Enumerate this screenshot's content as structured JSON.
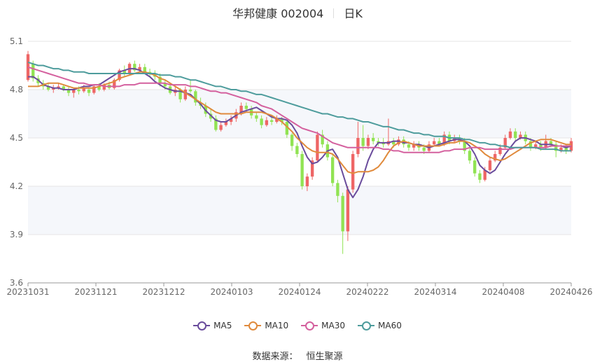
{
  "header": {
    "name": "华邦健康 002004",
    "period": "日K"
  },
  "source": {
    "label": "数据来源：",
    "value": "恒生聚源"
  },
  "chart_data": {
    "type": "candlestick",
    "ylim": [
      3.6,
      5.1
    ],
    "y_ticks": [
      "3.6",
      "3.9",
      "4.2",
      "4.5",
      "4.8",
      "5.1"
    ],
    "x_ticks": [
      "20231031",
      "20231121",
      "20231212",
      "20240103",
      "20240124",
      "20240222",
      "20240314",
      "20240408",
      "20240426"
    ],
    "colors": {
      "up": "#ee6666",
      "down": "#91e353"
    },
    "candles": [
      [
        4.86,
        5.02,
        5.04,
        4.85
      ],
      [
        4.96,
        4.87,
        4.98,
        4.85
      ],
      [
        4.87,
        4.84,
        4.89,
        4.82
      ],
      [
        4.84,
        4.82,
        4.86,
        4.8
      ],
      [
        4.82,
        4.8,
        4.84,
        4.79
      ],
      [
        4.8,
        4.81,
        4.83,
        4.78
      ],
      [
        4.81,
        4.82,
        4.84,
        4.8
      ],
      [
        4.82,
        4.8,
        4.83,
        4.79
      ],
      [
        4.8,
        4.78,
        4.82,
        4.76
      ],
      [
        4.78,
        4.8,
        4.81,
        4.75
      ],
      [
        4.8,
        4.79,
        4.82,
        4.77
      ],
      [
        4.79,
        4.81,
        4.83,
        4.78
      ],
      [
        4.8,
        4.78,
        4.81,
        4.76
      ],
      [
        4.78,
        4.82,
        4.83,
        4.77
      ],
      [
        4.82,
        4.8,
        4.84,
        4.79
      ],
      [
        4.8,
        4.83,
        4.84,
        4.79
      ],
      [
        4.83,
        4.81,
        4.85,
        4.8
      ],
      [
        4.81,
        4.86,
        4.87,
        4.8
      ],
      [
        4.86,
        4.92,
        4.93,
        4.85
      ],
      [
        4.92,
        4.9,
        4.95,
        4.88
      ],
      [
        4.9,
        4.96,
        4.97,
        4.89
      ],
      [
        4.96,
        4.92,
        4.98,
        4.91
      ],
      [
        4.92,
        4.94,
        4.96,
        4.91
      ],
      [
        4.94,
        4.91,
        4.96,
        4.9
      ],
      [
        4.91,
        4.9,
        4.93,
        4.88
      ],
      [
        4.9,
        4.88,
        4.92,
        4.86
      ],
      [
        4.88,
        4.84,
        4.9,
        4.82
      ],
      [
        4.84,
        4.82,
        4.86,
        4.8
      ],
      [
        4.82,
        4.78,
        4.84,
        4.77
      ],
      [
        4.78,
        4.8,
        4.82,
        4.76
      ],
      [
        4.8,
        4.74,
        4.81,
        4.72
      ],
      [
        4.74,
        4.8,
        4.82,
        4.73
      ],
      [
        4.8,
        4.79,
        4.86,
        4.78
      ],
      [
        4.79,
        4.72,
        4.8,
        4.7
      ],
      [
        4.72,
        4.7,
        4.75,
        4.68
      ],
      [
        4.7,
        4.65,
        4.72,
        4.63
      ],
      [
        4.65,
        4.62,
        4.68,
        4.6
      ],
      [
        4.62,
        4.55,
        4.64,
        4.54
      ],
      [
        4.55,
        4.58,
        4.6,
        4.54
      ],
      [
        4.58,
        4.6,
        4.62,
        4.57
      ],
      [
        4.6,
        4.62,
        4.64,
        4.58
      ],
      [
        4.62,
        4.66,
        4.68,
        4.6
      ],
      [
        4.66,
        4.7,
        4.72,
        4.64
      ],
      [
        4.7,
        4.68,
        4.72,
        4.66
      ],
      [
        4.68,
        4.64,
        4.7,
        4.62
      ],
      [
        4.64,
        4.62,
        4.66,
        4.6
      ],
      [
        4.62,
        4.58,
        4.64,
        4.56
      ],
      [
        4.58,
        4.61,
        4.63,
        4.57
      ],
      [
        4.61,
        4.6,
        4.63,
        4.58
      ],
      [
        4.6,
        4.62,
        4.64,
        4.59
      ],
      [
        4.62,
        4.6,
        4.63,
        4.58
      ],
      [
        4.6,
        4.52,
        4.61,
        4.5
      ],
      [
        4.52,
        4.45,
        4.53,
        4.42
      ],
      [
        4.45,
        4.4,
        4.47,
        4.38
      ],
      [
        4.4,
        4.2,
        4.42,
        4.18
      ],
      [
        4.2,
        4.26,
        4.28,
        4.17
      ],
      [
        4.26,
        4.36,
        4.38,
        4.24
      ],
      [
        4.36,
        4.52,
        4.54,
        4.35
      ],
      [
        4.52,
        4.46,
        4.55,
        4.44
      ],
      [
        4.46,
        4.38,
        4.48,
        4.36
      ],
      [
        4.38,
        4.22,
        4.4,
        4.2
      ],
      [
        4.22,
        4.14,
        4.24,
        4.1
      ],
      [
        4.14,
        3.92,
        4.16,
        3.78
      ],
      [
        3.92,
        4.18,
        4.2,
        3.86
      ],
      [
        4.18,
        4.4,
        4.42,
        4.16
      ],
      [
        4.4,
        4.5,
        4.6,
        4.38
      ],
      [
        4.5,
        4.45,
        4.58,
        4.42
      ],
      [
        4.45,
        4.5,
        4.52,
        4.43
      ],
      [
        4.5,
        4.48,
        4.53,
        4.46
      ],
      [
        4.48,
        4.47,
        4.5,
        4.45
      ],
      [
        4.47,
        4.46,
        4.5,
        4.44
      ],
      [
        4.46,
        4.48,
        4.62,
        4.45
      ],
      [
        4.48,
        4.46,
        4.5,
        4.44
      ],
      [
        4.46,
        4.49,
        4.51,
        4.45
      ],
      [
        4.49,
        4.46,
        4.51,
        4.44
      ],
      [
        4.46,
        4.44,
        4.48,
        4.42
      ],
      [
        4.44,
        4.46,
        4.48,
        4.42
      ],
      [
        4.46,
        4.44,
        4.48,
        4.42
      ],
      [
        4.44,
        4.42,
        4.46,
        4.4
      ],
      [
        4.42,
        4.46,
        4.48,
        4.41
      ],
      [
        4.46,
        4.48,
        4.5,
        4.45
      ],
      [
        4.48,
        4.46,
        4.5,
        4.45
      ],
      [
        4.46,
        4.52,
        4.54,
        4.45
      ],
      [
        4.52,
        4.48,
        4.54,
        4.46
      ],
      [
        4.48,
        4.5,
        4.52,
        4.47
      ],
      [
        4.5,
        4.48,
        4.52,
        4.46
      ],
      [
        4.48,
        4.42,
        4.5,
        4.4
      ],
      [
        4.42,
        4.36,
        4.44,
        4.34
      ],
      [
        4.36,
        4.28,
        4.38,
        4.26
      ],
      [
        4.28,
        4.24,
        4.3,
        4.22
      ],
      [
        4.24,
        4.3,
        4.32,
        4.23
      ],
      [
        4.3,
        4.36,
        4.38,
        4.29
      ],
      [
        4.36,
        4.4,
        4.42,
        4.35
      ],
      [
        4.4,
        4.44,
        4.46,
        4.39
      ],
      [
        4.44,
        4.5,
        4.52,
        4.43
      ],
      [
        4.5,
        4.54,
        4.56,
        4.49
      ],
      [
        4.54,
        4.5,
        4.56,
        4.48
      ],
      [
        4.5,
        4.52,
        4.54,
        4.49
      ],
      [
        4.52,
        4.48,
        4.54,
        4.46
      ],
      [
        4.48,
        4.44,
        4.5,
        4.42
      ],
      [
        4.44,
        4.46,
        4.48,
        4.43
      ],
      [
        4.46,
        4.44,
        4.48,
        4.42
      ],
      [
        4.44,
        4.48,
        4.52,
        4.43
      ],
      [
        4.48,
        4.46,
        4.5,
        4.44
      ],
      [
        4.46,
        4.42,
        4.48,
        4.38
      ],
      [
        4.42,
        4.44,
        4.46,
        4.41
      ],
      [
        4.44,
        4.42,
        4.46,
        4.4
      ],
      [
        4.42,
        4.48,
        4.5,
        4.41
      ]
    ],
    "series": [
      {
        "name": "MA5",
        "color": "#6a4c9c",
        "values": [
          4.88,
          4.88,
          4.86,
          4.83,
          4.82,
          4.81,
          4.81,
          4.8,
          4.8,
          4.8,
          4.81,
          4.82,
          4.82,
          4.83,
          4.83,
          4.85,
          4.87,
          4.89,
          4.91,
          4.92,
          4.93,
          4.93,
          4.92,
          4.9,
          4.88,
          4.85,
          4.83,
          4.81,
          4.8,
          4.79,
          4.79,
          4.78,
          4.77,
          4.74,
          4.71,
          4.67,
          4.64,
          4.61,
          4.6,
          4.6,
          4.62,
          4.64,
          4.66,
          4.67,
          4.68,
          4.69,
          4.67,
          4.65,
          4.63,
          4.62,
          4.62,
          4.61,
          4.58,
          4.53,
          4.45,
          4.38,
          4.34,
          4.35,
          4.38,
          4.42,
          4.43,
          4.38,
          4.28,
          4.18,
          4.13,
          4.18,
          4.26,
          4.36,
          4.43,
          4.47,
          4.47,
          4.47,
          4.48,
          4.48,
          4.47,
          4.47,
          4.46,
          4.46,
          4.45,
          4.44,
          4.45,
          4.46,
          4.47,
          4.48,
          4.49,
          4.49,
          4.48,
          4.45,
          4.4,
          4.33,
          4.3,
          4.28,
          4.3,
          4.35,
          4.4,
          4.44,
          4.48,
          4.5,
          4.5,
          4.49,
          4.48,
          4.46,
          4.46,
          4.46,
          4.45,
          4.45,
          4.44,
          4.45
        ]
      },
      {
        "name": "MA10",
        "color": "#e08a3c",
        "values": [
          4.82,
          4.82,
          4.82,
          4.83,
          4.84,
          4.84,
          4.84,
          4.83,
          4.82,
          4.81,
          4.81,
          4.81,
          4.81,
          4.81,
          4.82,
          4.83,
          4.84,
          4.85,
          4.87,
          4.88,
          4.89,
          4.9,
          4.91,
          4.91,
          4.9,
          4.89,
          4.87,
          4.86,
          4.84,
          4.82,
          4.8,
          4.78,
          4.76,
          4.74,
          4.72,
          4.7,
          4.68,
          4.66,
          4.65,
          4.65,
          4.65,
          4.65,
          4.65,
          4.66,
          4.66,
          4.66,
          4.66,
          4.65,
          4.64,
          4.62,
          4.6,
          4.57,
          4.54,
          4.5,
          4.47,
          4.44,
          4.42,
          4.41,
          4.41,
          4.41,
          4.4,
          4.37,
          4.33,
          4.29,
          4.28,
          4.29,
          4.29,
          4.29,
          4.3,
          4.32,
          4.36,
          4.41,
          4.45,
          4.47,
          4.48,
          4.47,
          4.46,
          4.45,
          4.45,
          4.45,
          4.45,
          4.45,
          4.46,
          4.47,
          4.47,
          4.48,
          4.48,
          4.47,
          4.45,
          4.43,
          4.4,
          4.38,
          4.37,
          4.36,
          4.37,
          4.39,
          4.41,
          4.43,
          4.45,
          4.47,
          4.48,
          4.49,
          4.49,
          4.49,
          4.48,
          4.47,
          4.46,
          4.46
        ]
      },
      {
        "name": "MA30",
        "color": "#d4609e",
        "values": [
          4.94,
          4.93,
          4.92,
          4.91,
          4.9,
          4.89,
          4.88,
          4.87,
          4.86,
          4.85,
          4.84,
          4.84,
          4.83,
          4.83,
          4.83,
          4.82,
          4.82,
          4.82,
          4.82,
          4.83,
          4.83,
          4.83,
          4.84,
          4.84,
          4.84,
          4.84,
          4.84,
          4.84,
          4.83,
          4.83,
          4.83,
          4.83,
          4.82,
          4.82,
          4.81,
          4.8,
          4.79,
          4.79,
          4.78,
          4.78,
          4.77,
          4.76,
          4.75,
          4.74,
          4.73,
          4.72,
          4.7,
          4.69,
          4.68,
          4.66,
          4.64,
          4.62,
          4.6,
          4.58,
          4.56,
          4.55,
          4.54,
          4.53,
          4.51,
          4.49,
          4.47,
          4.46,
          4.45,
          4.44,
          4.44,
          4.44,
          4.44,
          4.44,
          4.44,
          4.44,
          4.43,
          4.43,
          4.42,
          4.42,
          4.41,
          4.41,
          4.41,
          4.41,
          4.41,
          4.41,
          4.41,
          4.41,
          4.42,
          4.42,
          4.43,
          4.43,
          4.43,
          4.44,
          4.44,
          4.44,
          4.43,
          4.43,
          4.43,
          4.43,
          4.43,
          4.43,
          4.44,
          4.44,
          4.44,
          4.44,
          4.44,
          4.44,
          4.44,
          4.45,
          4.45,
          4.45,
          4.45,
          4.45
        ]
      },
      {
        "name": "MA60",
        "color": "#4d9c9c",
        "values": [
          4.97,
          4.96,
          4.95,
          4.95,
          4.94,
          4.93,
          4.93,
          4.92,
          4.92,
          4.91,
          4.91,
          4.91,
          4.9,
          4.9,
          4.9,
          4.9,
          4.9,
          4.9,
          4.9,
          4.9,
          4.9,
          4.9,
          4.9,
          4.9,
          4.9,
          4.9,
          4.89,
          4.89,
          4.89,
          4.88,
          4.88,
          4.87,
          4.86,
          4.86,
          4.85,
          4.84,
          4.83,
          4.82,
          4.82,
          4.81,
          4.8,
          4.8,
          4.79,
          4.79,
          4.78,
          4.77,
          4.77,
          4.76,
          4.75,
          4.74,
          4.73,
          4.72,
          4.71,
          4.7,
          4.69,
          4.68,
          4.67,
          4.66,
          4.65,
          4.65,
          4.64,
          4.63,
          4.63,
          4.62,
          4.62,
          4.61,
          4.6,
          4.6,
          4.59,
          4.58,
          4.57,
          4.57,
          4.56,
          4.55,
          4.55,
          4.54,
          4.53,
          4.53,
          4.52,
          4.52,
          4.51,
          4.51,
          4.51,
          4.5,
          4.5,
          4.5,
          4.49,
          4.49,
          4.48,
          4.47,
          4.47,
          4.46,
          4.46,
          4.45,
          4.45,
          4.44,
          4.44,
          4.44,
          4.44,
          4.44,
          4.44,
          4.43,
          4.43,
          4.43,
          4.43,
          4.42,
          4.42,
          4.42
        ]
      }
    ]
  }
}
